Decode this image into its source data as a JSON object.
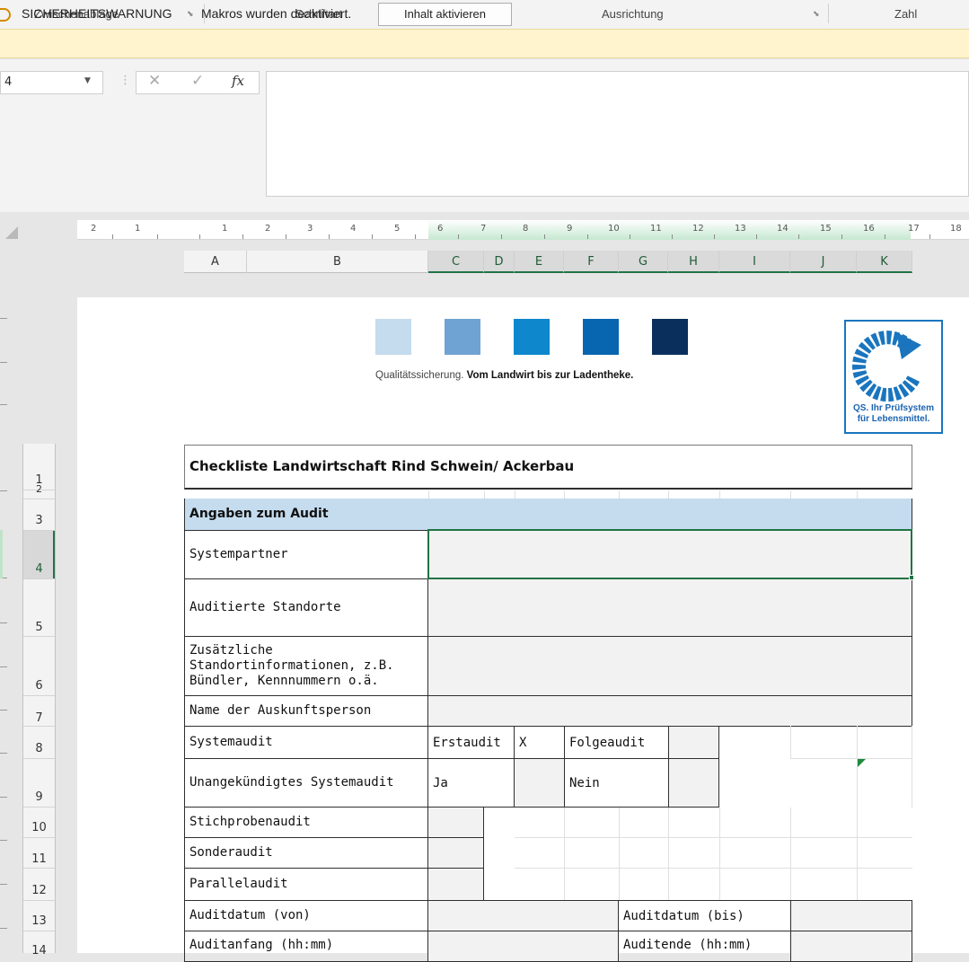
{
  "ribbon": {
    "groups": [
      "Zwischenablage",
      "Schriftart",
      "Ausrichtung",
      "Zahl"
    ]
  },
  "security_bar": {
    "title": "SICHERHEITSWARNUNG",
    "message": "Makros wurden deaktiviert.",
    "button": "Inhalt aktivieren"
  },
  "formula_bar": {
    "name_box": "4",
    "cancel_icon": "✕",
    "enter_icon": "✓",
    "fx_label": "fx",
    "content": ""
  },
  "ruler": {
    "labels": [
      "2",
      "1",
      "1",
      "2",
      "3",
      "4",
      "5",
      "6",
      "7",
      "8",
      "9",
      "10",
      "11",
      "12",
      "13",
      "14",
      "15",
      "16",
      "17",
      "18"
    ]
  },
  "columns": [
    "A",
    "B",
    "C",
    "D",
    "E",
    "F",
    "G",
    "H",
    "I",
    "J",
    "K"
  ],
  "rows": [
    "1",
    "2",
    "3",
    "4",
    "5",
    "6",
    "7",
    "8",
    "9",
    "10",
    "11",
    "12",
    "13",
    "14"
  ],
  "header": {
    "tagline_normal": "Qualitätssicherung. ",
    "tagline_bold": "Vom Landwirt bis zur Ladentheke.",
    "logo_line1": "QS. Ihr Prüfsystem",
    "logo_line2": "für Lebensmittel."
  },
  "colors": {
    "squares": [
      "#c5dbee",
      "#6fa3d3",
      "#0e87cd",
      "#0865b0",
      "#0a2f5c"
    ],
    "accent": "#217346",
    "section": "#c5dcef"
  },
  "sheet": {
    "title": "Checkliste Landwirtschaft Rind Schwein/ Ackerbau",
    "section": "Angaben zum Audit",
    "labels": {
      "systempartner": "Systempartner",
      "standorte": "Auditierte Standorte",
      "zusatz": "Zusätzliche Standortinformationen, z.B. Bündler, Kennnummern o.ä.",
      "auskunft": "Name der Auskunftsperson",
      "systemaudit": "Systemaudit",
      "erstaudit": "Erstaudit",
      "erstaudit_value": "X",
      "folgeaudit": "Folgeaudit",
      "unangekuendigt": "Unangekündigtes Systemaudit",
      "ja": "Ja",
      "nein": "Nein",
      "stichprobe": "Stichprobenaudit",
      "sonder": "Sonderaudit",
      "parallel": "Parallelaudit",
      "datum_von": "Auditdatum (von)",
      "datum_bis": "Auditdatum (bis)",
      "anfang": "Auditanfang (hh:mm)",
      "ende": "Auditende (hh:mm)"
    }
  }
}
